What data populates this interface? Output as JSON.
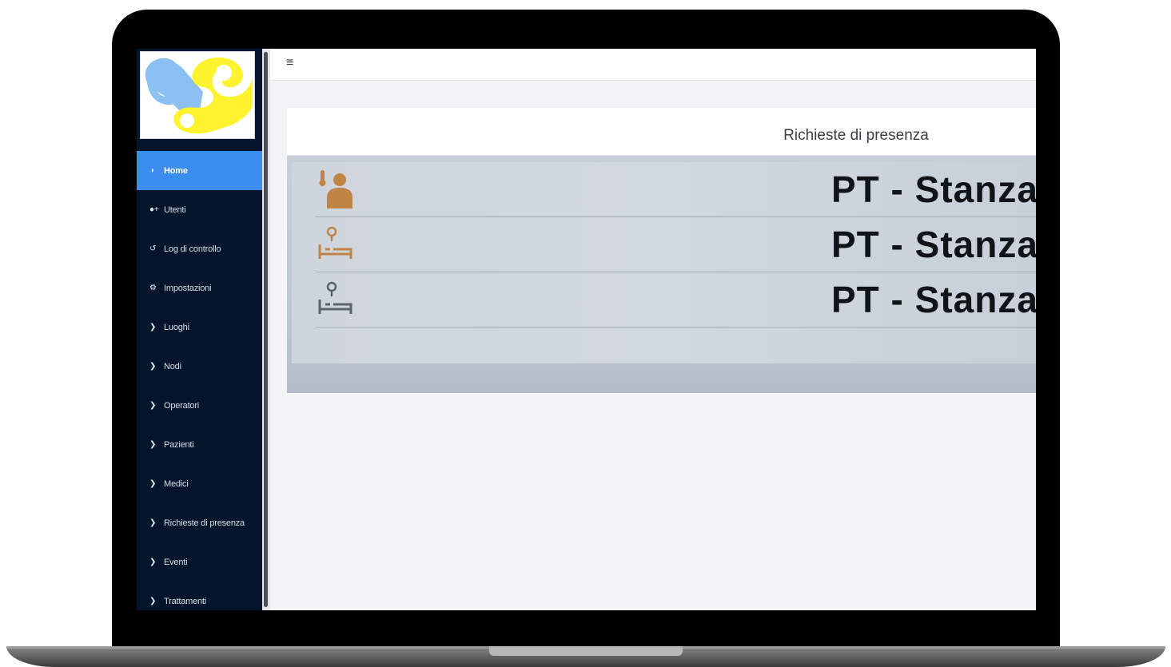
{
  "sidebar": {
    "items": [
      {
        "icon": "dashboard-icon",
        "label": "Home",
        "active": true
      },
      {
        "icon": "users-icon",
        "label": "Utenti"
      },
      {
        "icon": "history-icon",
        "label": "Log di controllo"
      },
      {
        "icon": "gear-icon",
        "label": "Impostazioni"
      },
      {
        "icon": "chevron-right-icon",
        "label": "Luoghi"
      },
      {
        "icon": "chevron-right-icon",
        "label": "Nodi"
      },
      {
        "icon": "chevron-right-icon",
        "label": "Operatori"
      },
      {
        "icon": "chevron-right-icon",
        "label": "Pazienti"
      },
      {
        "icon": "chevron-right-icon",
        "label": "Medici"
      },
      {
        "icon": "chevron-right-icon",
        "label": "Richieste di presenza"
      },
      {
        "icon": "chevron-right-icon",
        "label": "Eventi"
      },
      {
        "icon": "chevron-right-icon",
        "label": "Trattamenti"
      }
    ]
  },
  "topbar": {
    "menu_icon": "hamburger-icon"
  },
  "card": {
    "title": "Richieste di presenza",
    "rows": [
      {
        "icon": "patient-thermometer-icon",
        "text": "PT - Stanza"
      },
      {
        "icon": "bed-location-icon",
        "text": "PT - Stanza"
      },
      {
        "icon": "bed-location-icon",
        "text": "PT - Stanza"
      }
    ]
  },
  "colors": {
    "sidebar_bg": "#02152b",
    "active_item": "#3b8ef0",
    "logo_blue": "#8cc0f2",
    "logo_yellow": "#fff22e",
    "icon_orange": "#c08545"
  }
}
